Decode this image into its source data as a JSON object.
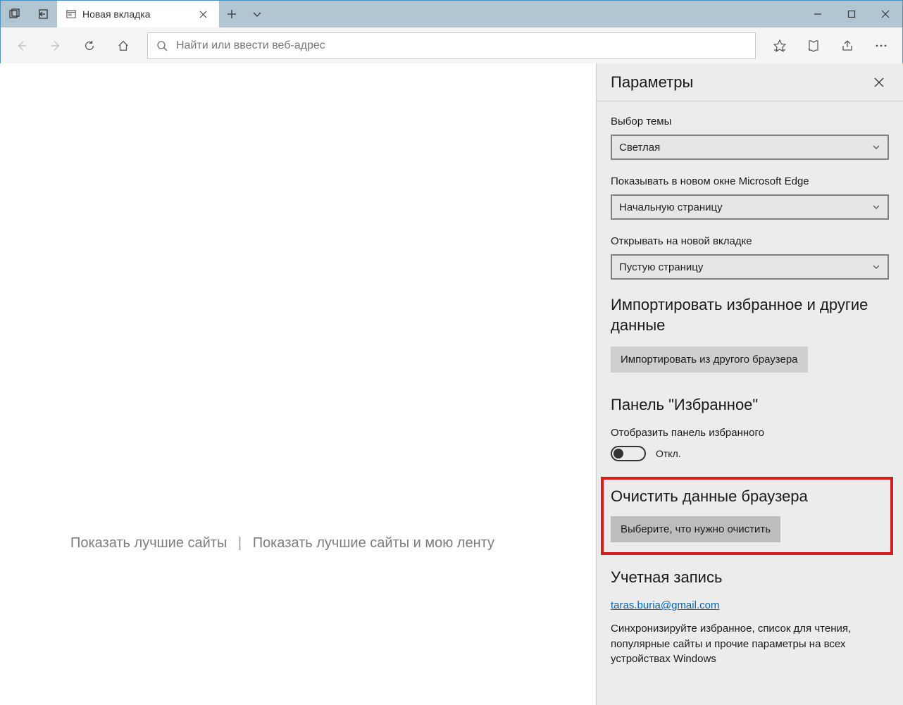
{
  "titlebar": {
    "tab_title": "Новая вкладка"
  },
  "toolbar": {
    "address_placeholder": "Найти или ввести веб-адрес"
  },
  "newtab": {
    "link_top_sites": "Показать лучшие сайты",
    "link_top_sites_feed": "Показать лучшие сайты и мою ленту"
  },
  "settings": {
    "title": "Параметры",
    "theme_label": "Выбор темы",
    "theme_value": "Светлая",
    "open_with_label": "Показывать в новом окне Microsoft Edge",
    "open_with_value": "Начальную страницу",
    "new_tab_label": "Открывать на новой вкладке",
    "new_tab_value": "Пустую страницу",
    "import_heading": "Импортировать избранное и другие данные",
    "import_button": "Импортировать из другого браузера",
    "favorites_heading": "Панель \"Избранное\"",
    "favorites_bar_label": "Отобразить панель избранного",
    "favorites_bar_state": "Откл.",
    "clear_heading": "Очистить данные браузера",
    "clear_button": "Выберите, что нужно очистить",
    "account_heading": "Учетная запись",
    "account_email": "taras.buria@gmail.com",
    "account_desc": "Синхронизируйте избранное, список для чтения, популярные сайты и прочие параметры на всех устройствах Windows"
  }
}
